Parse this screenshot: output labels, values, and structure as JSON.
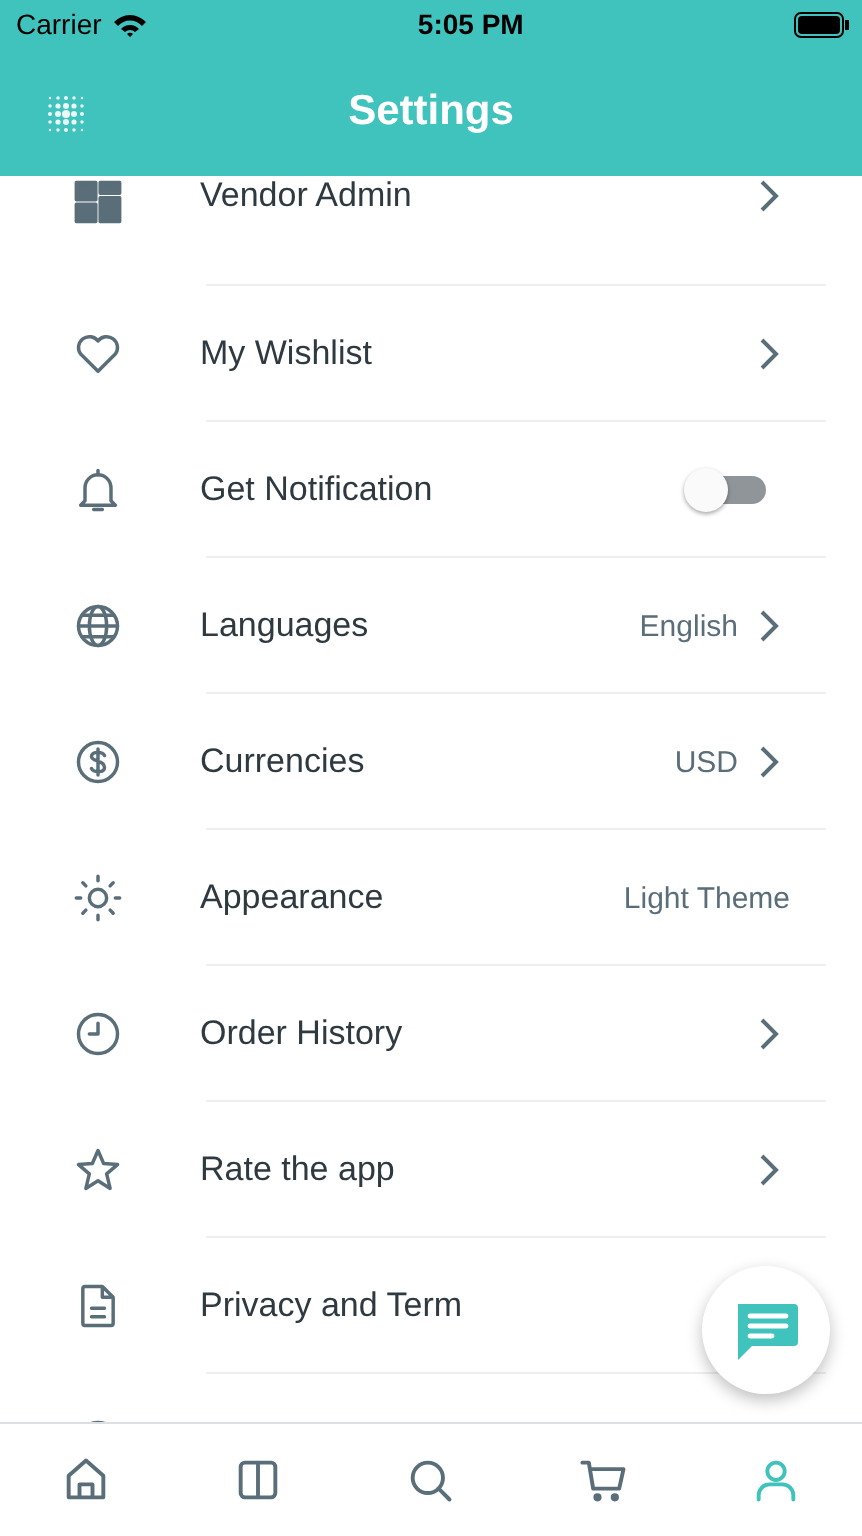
{
  "status_bar": {
    "carrier": "Carrier",
    "time": "5:05 PM"
  },
  "header": {
    "title": "Settings"
  },
  "items": [
    {
      "label": "Vendor Admin",
      "chevron": true
    },
    {
      "label": "My Wishlist",
      "chevron": true
    },
    {
      "label": "Get Notification",
      "kind": "toggle",
      "on": false
    },
    {
      "label": "Languages",
      "value": "English",
      "chevron": true
    },
    {
      "label": "Currencies",
      "value": "USD",
      "chevron": true
    },
    {
      "label": "Appearance",
      "value": "Light Theme",
      "chevron": false
    },
    {
      "label": "Order History",
      "chevron": true
    },
    {
      "label": "Rate the app",
      "chevron": true
    },
    {
      "label": "Privacy and Term",
      "chevron": false
    },
    {
      "chevron": false
    }
  ],
  "tabs": [
    {
      "selected": false
    },
    {
      "selected": false
    },
    {
      "selected": false
    },
    {
      "selected": false
    },
    {
      "selected": true
    }
  ]
}
